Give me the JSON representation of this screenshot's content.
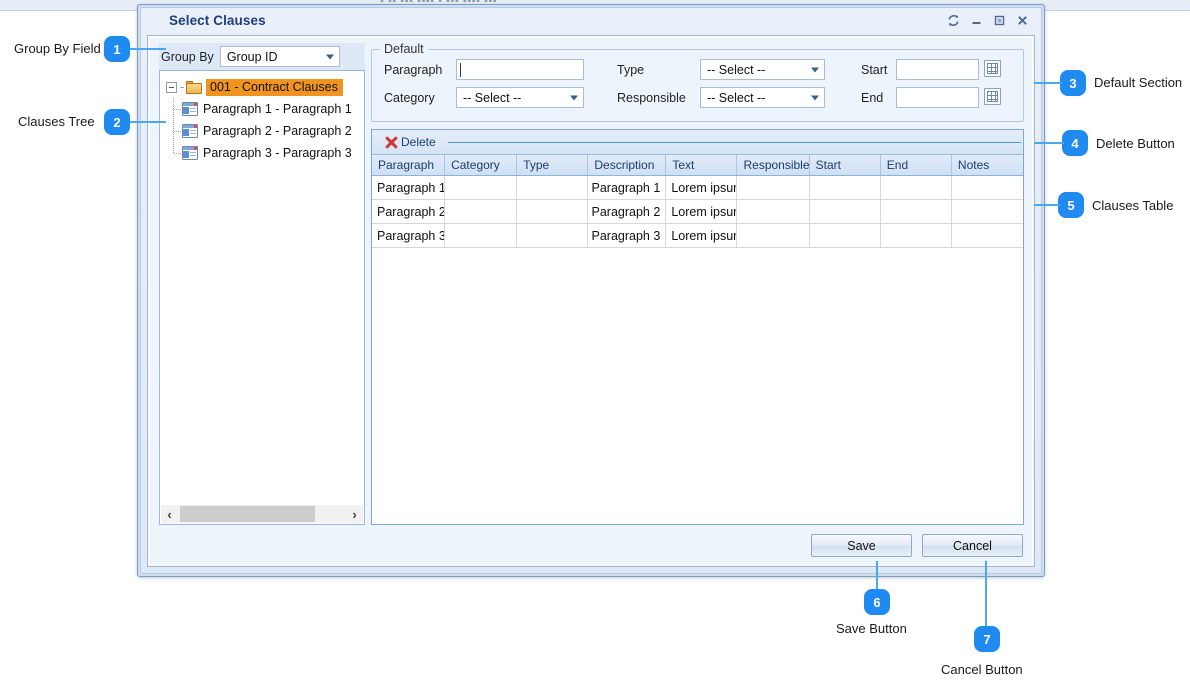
{
  "window": {
    "title": "Select Clauses",
    "buttons": [
      {
        "name": "refresh-icon",
        "glyph": "⟳"
      },
      {
        "name": "minimize-icon",
        "glyph": "—"
      },
      {
        "name": "maximize-icon",
        "glyph": "▢"
      },
      {
        "name": "close-icon",
        "glyph": "✕"
      }
    ]
  },
  "left": {
    "group_by_label": "Group By",
    "group_by_value": "Group ID",
    "tree": {
      "root": "001 - Contract Clauses",
      "children": [
        "Paragraph 1 - Paragraph 1",
        "Paragraph 2 - Paragraph 2",
        "Paragraph 3 - Paragraph 3"
      ]
    },
    "scroll_left": "‹",
    "scroll_right": "›"
  },
  "default_section": {
    "legend": "Default",
    "fields": {
      "paragraph_label": "Paragraph",
      "paragraph_value": "",
      "category_label": "Category",
      "category_value": "-- Select --",
      "type_label": "Type",
      "type_value": "-- Select --",
      "responsible_label": "Responsible",
      "responsible_value": "-- Select --",
      "start_label": "Start",
      "start_value": "",
      "end_label": "End",
      "end_value": ""
    }
  },
  "grid": {
    "delete_label": "Delete",
    "columns": [
      "Paragraph",
      "Category",
      "Type",
      "Description",
      "Text",
      "Responsible",
      "Start",
      "End",
      "Notes"
    ],
    "rows": [
      {
        "paragraph": "Paragraph 1",
        "category": "",
        "type": "",
        "description": "Paragraph 1",
        "text": "Lorem ipsum",
        "responsible": "",
        "start": "",
        "end": "",
        "notes": ""
      },
      {
        "paragraph": "Paragraph 2",
        "category": "",
        "type": "",
        "description": "Paragraph 2",
        "text": "Lorem ipsum",
        "responsible": "",
        "start": "",
        "end": "",
        "notes": ""
      },
      {
        "paragraph": "Paragraph 3",
        "category": "",
        "type": "",
        "description": "Paragraph 3",
        "text": "Lorem ipsum",
        "responsible": "",
        "start": "",
        "end": "",
        "notes": ""
      }
    ]
  },
  "footer": {
    "save_label": "Save",
    "cancel_label": "Cancel"
  },
  "annotations": {
    "accent_color": "#1f8bf0",
    "items": [
      {
        "number": "1",
        "label": "Group By Field"
      },
      {
        "number": "2",
        "label": "Clauses Tree"
      },
      {
        "number": "3",
        "label": "Default Section"
      },
      {
        "number": "4",
        "label": "Delete Button"
      },
      {
        "number": "5",
        "label": "Clauses Table"
      },
      {
        "number": "6",
        "label": "Save Button"
      },
      {
        "number": "7",
        "label": "Cancel Button"
      }
    ]
  }
}
